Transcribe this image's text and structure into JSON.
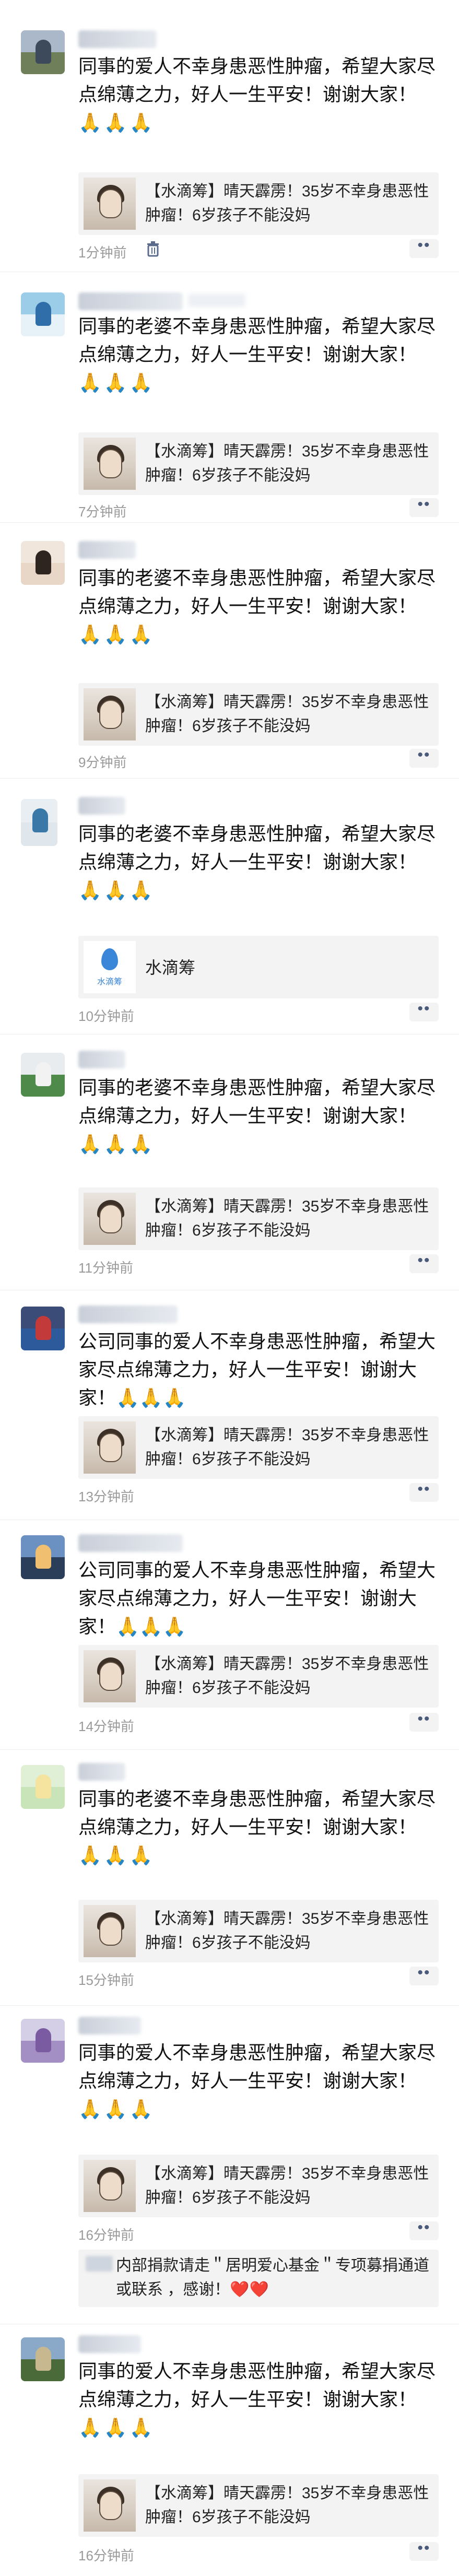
{
  "posts": [
    {
      "text": "同事的爱人不幸身患恶性肿瘤，希望大家尽点绵薄之力，好人一生平安！谢谢大家！",
      "emoji": "🙏🙏🙏",
      "card": {
        "type": "article",
        "text": "【水滴筹】晴天霹雳！35岁不幸身患恶性肿瘤！6岁孩子不能没妈"
      },
      "time": "1分钟前"
    },
    {
      "text": "同事的老婆不幸身患恶性肿瘤，希望大家尽点绵薄之力，好人一生平安！谢谢大家！",
      "emoji": "🙏🙏🙏",
      "card": {
        "type": "article",
        "text": "【水滴筹】晴天霹雳！35岁不幸身患恶性肿瘤！6岁孩子不能没妈"
      },
      "time": "7分钟前"
    },
    {
      "text": "同事的老婆不幸身患恶性肿瘤，希望大家尽点绵薄之力，好人一生平安！谢谢大家！",
      "emoji": "🙏🙏🙏",
      "card": {
        "type": "article",
        "text": "【水滴筹】晴天霹雳！35岁不幸身患恶性肿瘤！6岁孩子不能没妈"
      },
      "time": "9分钟前"
    },
    {
      "text": "同事的老婆不幸身患恶性肿瘤，希望大家尽点绵薄之力，好人一生平安！谢谢大家！",
      "emoji": "🙏🙏🙏",
      "card": {
        "type": "app",
        "logo_text": "水滴筹",
        "name": "水滴筹"
      },
      "time": "10分钟前"
    },
    {
      "text": "同事的老婆不幸身患恶性肿瘤，希望大家尽点绵薄之力，好人一生平安！谢谢大家！",
      "emoji": "🙏🙏🙏",
      "card": {
        "type": "article",
        "text": "【水滴筹】晴天霹雳！35岁不幸身患恶性肿瘤！6岁孩子不能没妈"
      },
      "time": "11分钟前"
    },
    {
      "text": "公司同事的爱人不幸身患恶性肿瘤，希望大家尽点绵薄之力，好人一生平安！谢谢大家！🙏🙏🙏",
      "emoji": "",
      "card": {
        "type": "article",
        "text": "【水滴筹】晴天霹雳！35岁不幸身患恶性肿瘤！6岁孩子不能没妈"
      },
      "time": "13分钟前"
    },
    {
      "text": "公司同事的爱人不幸身患恶性肿瘤，希望大家尽点绵薄之力，好人一生平安！谢谢大家！🙏🙏🙏",
      "emoji": "",
      "card": {
        "type": "article",
        "text": "【水滴筹】晴天霹雳！35岁不幸身患恶性肿瘤！6岁孩子不能没妈"
      },
      "time": "14分钟前"
    },
    {
      "text": "同事的老婆不幸身患恶性肿瘤，希望大家尽点绵薄之力，好人一生平安！谢谢大家！",
      "emoji": "🙏🙏🙏",
      "card": {
        "type": "article",
        "text": "【水滴筹】晴天霹雳！35岁不幸身患恶性肿瘤！6岁孩子不能没妈"
      },
      "time": "15分钟前"
    },
    {
      "text": "同事的爱人不幸身患恶性肿瘤，希望大家尽点绵薄之力，好人一生平安！谢谢大家！",
      "emoji": "🙏🙏🙏",
      "card": {
        "type": "article",
        "text": "【水滴筹】晴天霹雳！35岁不幸身患恶性肿瘤！6岁孩子不能没妈"
      },
      "time": "16分钟前",
      "comment": "内部捐款请走＂居明爱心基金＂专项募捐通道或联系 ，感谢！❤️❤️"
    },
    {
      "text": "同事的爱人不幸身患恶性肿瘤，希望大家尽点绵薄之力，好人一生平安！谢谢大家！",
      "emoji": "🙏🙏🙏",
      "card": {
        "type": "article",
        "text": "【水滴筹】晴天霹雳！35岁不幸身患恶性肿瘤！6岁孩子不能没妈"
      },
      "time": "16分钟前"
    }
  ],
  "more_icon": "more-dots-icon",
  "trash_icon": "trash-icon",
  "colors": {
    "text": "#111111",
    "time": "#9a9a9a",
    "card_bg": "#f3f3f3",
    "link_blue": "#4a5a7a",
    "brand": "#3a86d8"
  }
}
